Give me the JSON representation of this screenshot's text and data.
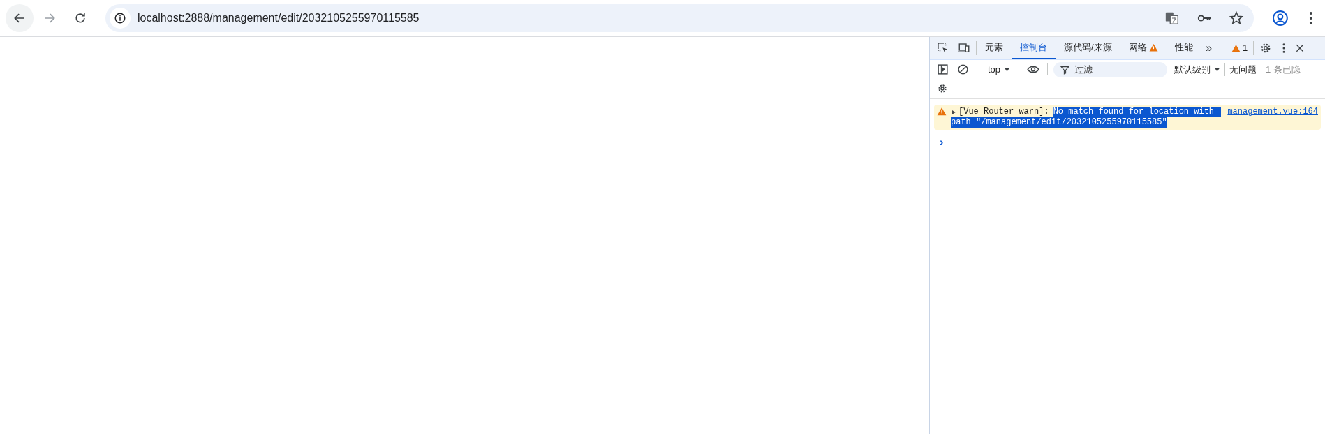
{
  "browser": {
    "nav": [
      {
        "kind": "back",
        "disabled": false
      },
      {
        "kind": "forward",
        "disabled": true
      },
      {
        "kind": "reload",
        "disabled": false
      }
    ],
    "url": "localhost:2888/management/edit/2032105255970115585"
  },
  "devtools": {
    "tabs": [
      {
        "label": "元素",
        "selected": false,
        "warning": false
      },
      {
        "label": "控制台",
        "selected": true,
        "warning": false
      },
      {
        "label": "源代码/来源",
        "selected": false,
        "warning": false
      },
      {
        "label": "网络",
        "selected": false,
        "warning": true
      },
      {
        "label": "性能",
        "selected": false,
        "warning": false
      }
    ],
    "more": "»",
    "warning_count": "1",
    "toolbar": {
      "context": "top",
      "filter_placeholder": "过滤",
      "level": "默认级别",
      "issues": "无问题",
      "hidden": "1 条已隐"
    },
    "messages": [
      {
        "kind": "warning",
        "prefix": "[Vue Router warn]:",
        "highlighted": [
          "No match found for location with",
          "path \"/management/edit/2032105255970115585\""
        ],
        "source": "management.vue:164"
      }
    ],
    "prompt": "›"
  }
}
